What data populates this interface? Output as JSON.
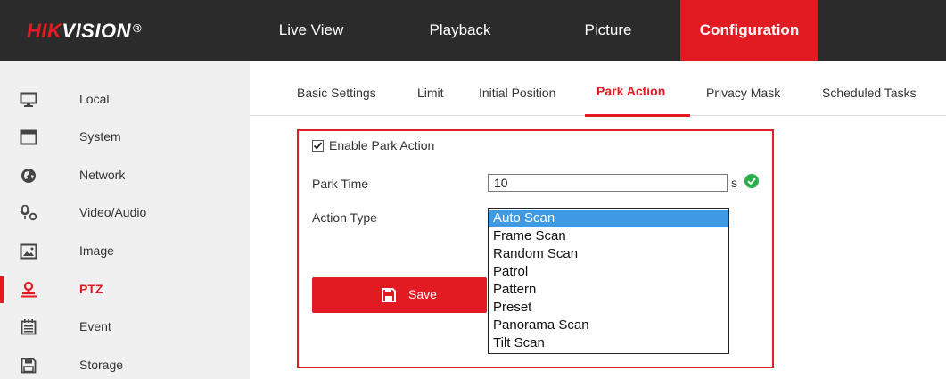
{
  "brand": {
    "logo_part1": "HIK",
    "logo_part2": "VISION",
    "logo_reg": "®",
    "accent_color": "#e21b22"
  },
  "topnav": {
    "items": [
      {
        "label": "Live View",
        "active": false
      },
      {
        "label": "Playback",
        "active": false
      },
      {
        "label": "Picture",
        "active": false
      },
      {
        "label": "Configuration",
        "active": true
      }
    ]
  },
  "sidebar": {
    "items": [
      {
        "label": "Local",
        "icon": "monitor-icon"
      },
      {
        "label": "System",
        "icon": "system-window-icon"
      },
      {
        "label": "Network",
        "icon": "globe-icon"
      },
      {
        "label": "Video/Audio",
        "icon": "microphone-icon"
      },
      {
        "label": "Image",
        "icon": "image-icon"
      },
      {
        "label": "PTZ",
        "icon": "ptz-camera-icon",
        "active": true
      },
      {
        "label": "Event",
        "icon": "calendar-icon"
      },
      {
        "label": "Storage",
        "icon": "floppy-disk-icon"
      }
    ]
  },
  "tabs": {
    "items": [
      {
        "label": "Basic Settings",
        "active": false
      },
      {
        "label": "Limit",
        "active": false
      },
      {
        "label": "Initial Position",
        "active": false
      },
      {
        "label": "Park Action",
        "active": true
      },
      {
        "label": "Privacy Mask",
        "active": false
      },
      {
        "label": "Scheduled Tasks",
        "active": false
      }
    ]
  },
  "park_action": {
    "enable_label": "Enable Park Action",
    "enable_checked": true,
    "park_time_label": "Park Time",
    "park_time_value": "10",
    "park_time_unit": "s",
    "action_type_label": "Action Type",
    "action_type_options": [
      {
        "label": "Auto Scan",
        "selected": true
      },
      {
        "label": "Frame Scan",
        "selected": false
      },
      {
        "label": "Random Scan",
        "selected": false
      },
      {
        "label": "Patrol",
        "selected": false
      },
      {
        "label": "Pattern",
        "selected": false
      },
      {
        "label": "Preset",
        "selected": false
      },
      {
        "label": "Panorama Scan",
        "selected": false
      },
      {
        "label": "Tilt Scan",
        "selected": false
      }
    ],
    "save_label": "Save",
    "highlight_color": "#e02027",
    "valid_color": "#2eae4a"
  }
}
